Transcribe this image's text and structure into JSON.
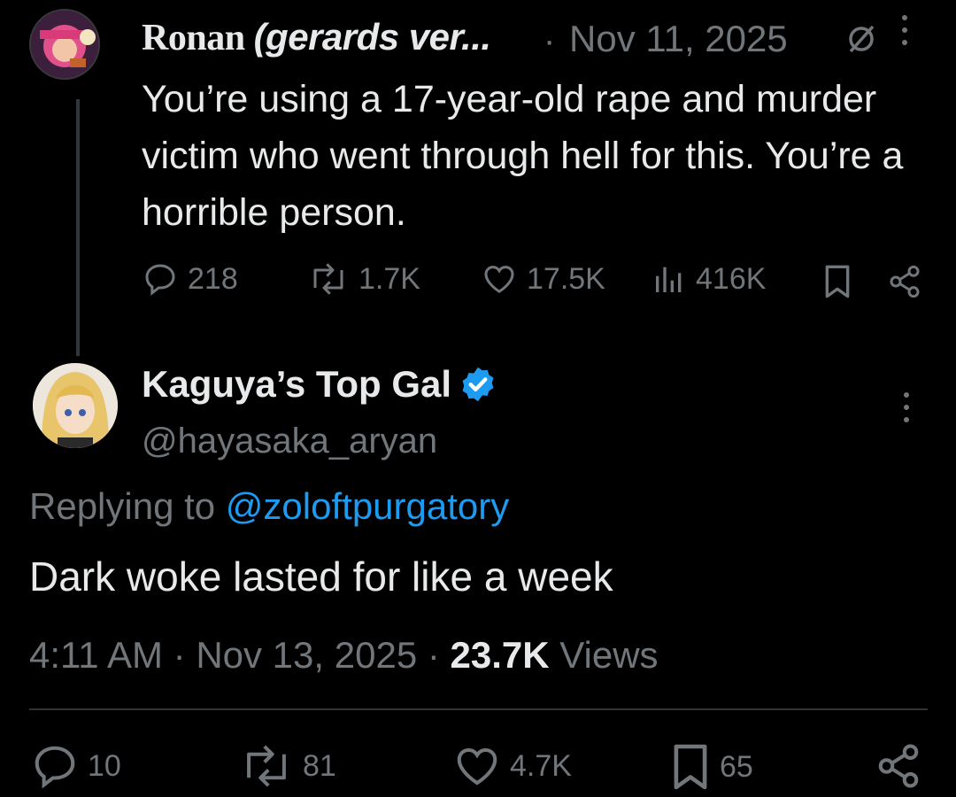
{
  "parent_tweet": {
    "display_name_prefix": "Ronan ",
    "display_name_italic": "(gerards ver...",
    "separator": "·",
    "date": "Nov 11, 2025",
    "muted_icon": "muted-slash-icon",
    "more_icon": "more-vertical-icon",
    "text": "You’re using a 17-year-old rape and murder victim who went through hell for this. You’re a horrible person.",
    "actions": {
      "replies": "218",
      "retweets": "1.7K",
      "likes": "17.5K",
      "views": "416K"
    }
  },
  "main_tweet": {
    "display_name": "Kaguya’s Top Gal",
    "verified_icon": "verified-badge-icon",
    "handle": "@hayasaka_aryan",
    "more_icon": "more-vertical-icon",
    "replying_prefix": "Replying to",
    "replying_mention": "@zoloftpurgatory",
    "text": "Dark woke lasted for like a week",
    "time": "4:11 AM",
    "date": "Nov 13, 2025",
    "dot": "·",
    "views_count": "23.7K",
    "views_label": "Views",
    "actions": {
      "replies": "10",
      "retweets": "81",
      "likes": "4.7K",
      "bookmarks": "65"
    }
  },
  "colors": {
    "background": "#000000",
    "text": "#e7e9ea",
    "muted": "#71767b",
    "link": "#1d9bf0",
    "verified": "#1d9bf0",
    "divider": "#2f3336"
  }
}
